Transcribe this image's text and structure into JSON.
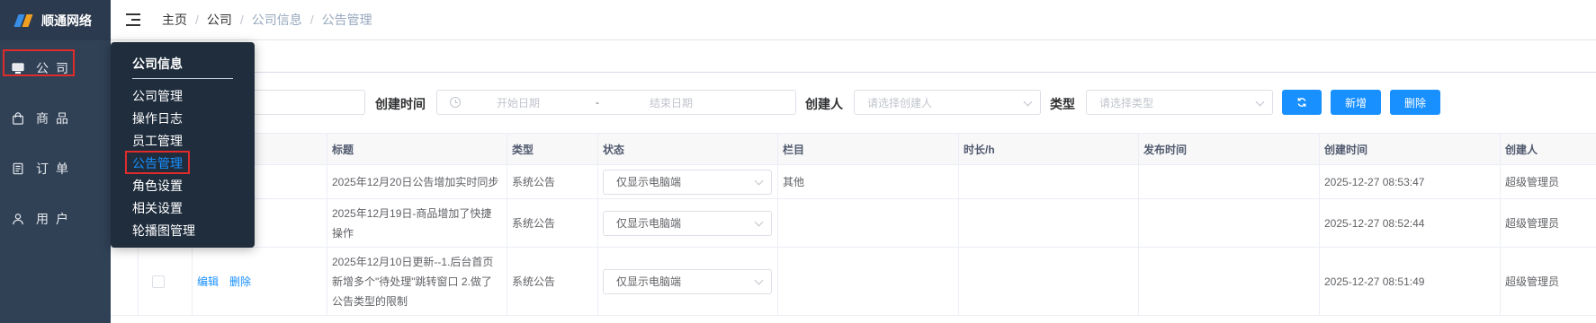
{
  "sidebar": {
    "logo_text": "顺通网络",
    "items": [
      {
        "label": "公司",
        "icon": "monitor-icon"
      },
      {
        "label": "商品",
        "icon": "shopping-bag-icon"
      },
      {
        "label": "订单",
        "icon": "document-icon"
      },
      {
        "label": "用户",
        "icon": "user-icon"
      }
    ]
  },
  "header": {
    "breadcrumb": [
      "主页",
      "公司",
      "公司信息",
      "公告管理"
    ]
  },
  "flyout": {
    "title": "公司信息",
    "items": [
      "公司管理",
      "操作日志",
      "员工管理",
      "公告管理",
      "角色设置",
      "相关设置",
      "轮播图管理"
    ],
    "active_index": 3
  },
  "filters": {
    "created_time_label": "创建时间",
    "start_date_placeholder": "开始日期",
    "date_separator": "-",
    "end_date_placeholder": "结束日期",
    "creator_label": "创建人",
    "creator_placeholder": "请选择创建人",
    "type_label": "类型",
    "type_placeholder": "请选择类型",
    "refresh_icon": "refresh-icon",
    "add_label": "新增",
    "delete_label": "删除"
  },
  "table": {
    "columns": [
      "标题",
      "类型",
      "状态",
      "栏目",
      "时长/h",
      "发布时间",
      "创建时间",
      "创建人"
    ],
    "rows": [
      {
        "title": "2025年12月20日公告增加实时同步",
        "type": "系统公告",
        "status": "仅显示电脑端",
        "column": "其他",
        "duration": "",
        "publish_time": "",
        "created_at": "2025-12-27 08:53:47",
        "creator": "超级管理员"
      },
      {
        "title": "2025年12月19日-商品增加了快捷操作",
        "type": "系统公告",
        "status": "仅显示电脑端",
        "column": "",
        "duration": "",
        "publish_time": "",
        "created_at": "2025-12-27 08:52:44",
        "creator": "超级管理员"
      },
      {
        "title": "2025年12月10日更新--1.后台首页新增多个\"待处理\"跳转窗口 2.做了公告类型的限制",
        "type": "系统公告",
        "status": "仅显示电脑端",
        "column": "",
        "duration": "",
        "publish_time": "",
        "created_at": "2025-12-27 08:51:49",
        "creator": "超级管理员",
        "actions": [
          "编辑",
          "删除"
        ]
      }
    ]
  },
  "colors": {
    "sidebar_bg": "#304156",
    "flyout_bg": "#1f2d3d",
    "primary": "#1890ff",
    "highlight_border": "#e02b2b"
  }
}
